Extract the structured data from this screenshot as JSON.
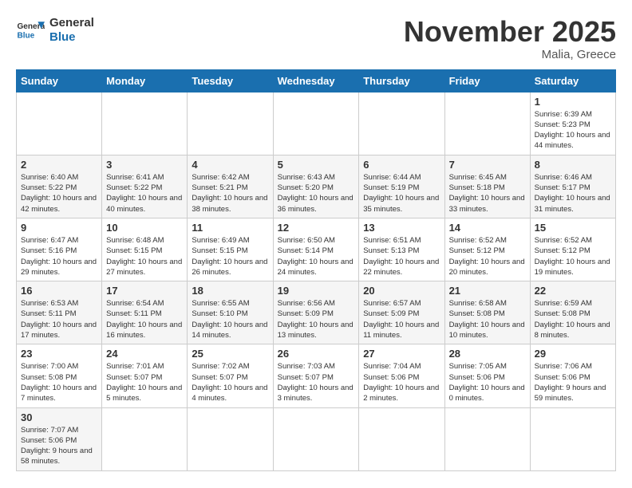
{
  "header": {
    "logo_general": "General",
    "logo_blue": "Blue",
    "month_title": "November 2025",
    "location": "Malia, Greece"
  },
  "days_of_week": [
    "Sunday",
    "Monday",
    "Tuesday",
    "Wednesday",
    "Thursday",
    "Friday",
    "Saturday"
  ],
  "weeks": [
    [
      {
        "day": "",
        "info": ""
      },
      {
        "day": "",
        "info": ""
      },
      {
        "day": "",
        "info": ""
      },
      {
        "day": "",
        "info": ""
      },
      {
        "day": "",
        "info": ""
      },
      {
        "day": "",
        "info": ""
      },
      {
        "day": "1",
        "info": "Sunrise: 6:39 AM\nSunset: 5:23 PM\nDaylight: 10 hours and 44 minutes."
      }
    ],
    [
      {
        "day": "2",
        "info": "Sunrise: 6:40 AM\nSunset: 5:22 PM\nDaylight: 10 hours and 42 minutes."
      },
      {
        "day": "3",
        "info": "Sunrise: 6:41 AM\nSunset: 5:22 PM\nDaylight: 10 hours and 40 minutes."
      },
      {
        "day": "4",
        "info": "Sunrise: 6:42 AM\nSunset: 5:21 PM\nDaylight: 10 hours and 38 minutes."
      },
      {
        "day": "5",
        "info": "Sunrise: 6:43 AM\nSunset: 5:20 PM\nDaylight: 10 hours and 36 minutes."
      },
      {
        "day": "6",
        "info": "Sunrise: 6:44 AM\nSunset: 5:19 PM\nDaylight: 10 hours and 35 minutes."
      },
      {
        "day": "7",
        "info": "Sunrise: 6:45 AM\nSunset: 5:18 PM\nDaylight: 10 hours and 33 minutes."
      },
      {
        "day": "8",
        "info": "Sunrise: 6:46 AM\nSunset: 5:17 PM\nDaylight: 10 hours and 31 minutes."
      }
    ],
    [
      {
        "day": "9",
        "info": "Sunrise: 6:47 AM\nSunset: 5:16 PM\nDaylight: 10 hours and 29 minutes."
      },
      {
        "day": "10",
        "info": "Sunrise: 6:48 AM\nSunset: 5:15 PM\nDaylight: 10 hours and 27 minutes."
      },
      {
        "day": "11",
        "info": "Sunrise: 6:49 AM\nSunset: 5:15 PM\nDaylight: 10 hours and 26 minutes."
      },
      {
        "day": "12",
        "info": "Sunrise: 6:50 AM\nSunset: 5:14 PM\nDaylight: 10 hours and 24 minutes."
      },
      {
        "day": "13",
        "info": "Sunrise: 6:51 AM\nSunset: 5:13 PM\nDaylight: 10 hours and 22 minutes."
      },
      {
        "day": "14",
        "info": "Sunrise: 6:52 AM\nSunset: 5:12 PM\nDaylight: 10 hours and 20 minutes."
      },
      {
        "day": "15",
        "info": "Sunrise: 6:52 AM\nSunset: 5:12 PM\nDaylight: 10 hours and 19 minutes."
      }
    ],
    [
      {
        "day": "16",
        "info": "Sunrise: 6:53 AM\nSunset: 5:11 PM\nDaylight: 10 hours and 17 minutes."
      },
      {
        "day": "17",
        "info": "Sunrise: 6:54 AM\nSunset: 5:11 PM\nDaylight: 10 hours and 16 minutes."
      },
      {
        "day": "18",
        "info": "Sunrise: 6:55 AM\nSunset: 5:10 PM\nDaylight: 10 hours and 14 minutes."
      },
      {
        "day": "19",
        "info": "Sunrise: 6:56 AM\nSunset: 5:09 PM\nDaylight: 10 hours and 13 minutes."
      },
      {
        "day": "20",
        "info": "Sunrise: 6:57 AM\nSunset: 5:09 PM\nDaylight: 10 hours and 11 minutes."
      },
      {
        "day": "21",
        "info": "Sunrise: 6:58 AM\nSunset: 5:08 PM\nDaylight: 10 hours and 10 minutes."
      },
      {
        "day": "22",
        "info": "Sunrise: 6:59 AM\nSunset: 5:08 PM\nDaylight: 10 hours and 8 minutes."
      }
    ],
    [
      {
        "day": "23",
        "info": "Sunrise: 7:00 AM\nSunset: 5:08 PM\nDaylight: 10 hours and 7 minutes."
      },
      {
        "day": "24",
        "info": "Sunrise: 7:01 AM\nSunset: 5:07 PM\nDaylight: 10 hours and 5 minutes."
      },
      {
        "day": "25",
        "info": "Sunrise: 7:02 AM\nSunset: 5:07 PM\nDaylight: 10 hours and 4 minutes."
      },
      {
        "day": "26",
        "info": "Sunrise: 7:03 AM\nSunset: 5:07 PM\nDaylight: 10 hours and 3 minutes."
      },
      {
        "day": "27",
        "info": "Sunrise: 7:04 AM\nSunset: 5:06 PM\nDaylight: 10 hours and 2 minutes."
      },
      {
        "day": "28",
        "info": "Sunrise: 7:05 AM\nSunset: 5:06 PM\nDaylight: 10 hours and 0 minutes."
      },
      {
        "day": "29",
        "info": "Sunrise: 7:06 AM\nSunset: 5:06 PM\nDaylight: 9 hours and 59 minutes."
      }
    ],
    [
      {
        "day": "30",
        "info": "Sunrise: 7:07 AM\nSunset: 5:06 PM\nDaylight: 9 hours and 58 minutes."
      },
      {
        "day": "",
        "info": ""
      },
      {
        "day": "",
        "info": ""
      },
      {
        "day": "",
        "info": ""
      },
      {
        "day": "",
        "info": ""
      },
      {
        "day": "",
        "info": ""
      },
      {
        "day": "",
        "info": ""
      }
    ]
  ]
}
